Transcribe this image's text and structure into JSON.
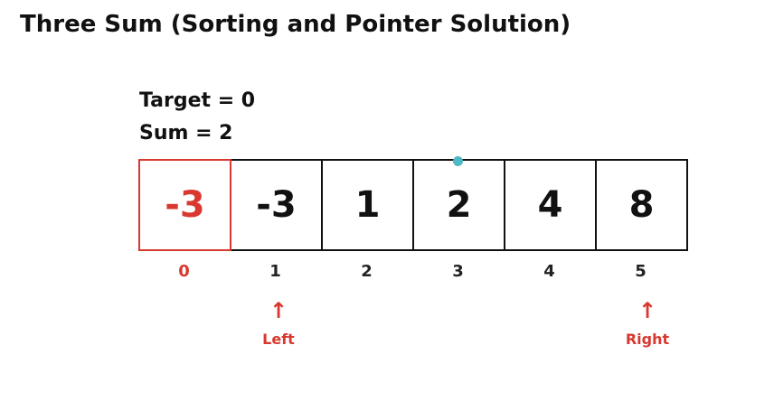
{
  "title": "Three Sum (Sorting and Pointer Solution)",
  "target_text": "Target = 0",
  "sum_text": "Sum = 2",
  "array": {
    "values": [
      "-3",
      "-3",
      "1",
      "2",
      "4",
      "8"
    ],
    "indices": [
      "0",
      "1",
      "2",
      "3",
      "4",
      "5"
    ],
    "active_index": 0
  },
  "pointers": {
    "left": {
      "label": "Left",
      "index": 1
    },
    "right": {
      "label": "Right",
      "index": 5
    },
    "arrow": "↑"
  },
  "colors": {
    "highlight": "#d8382f",
    "border": "#111111",
    "cursor_dot": "#4fb8c4"
  }
}
